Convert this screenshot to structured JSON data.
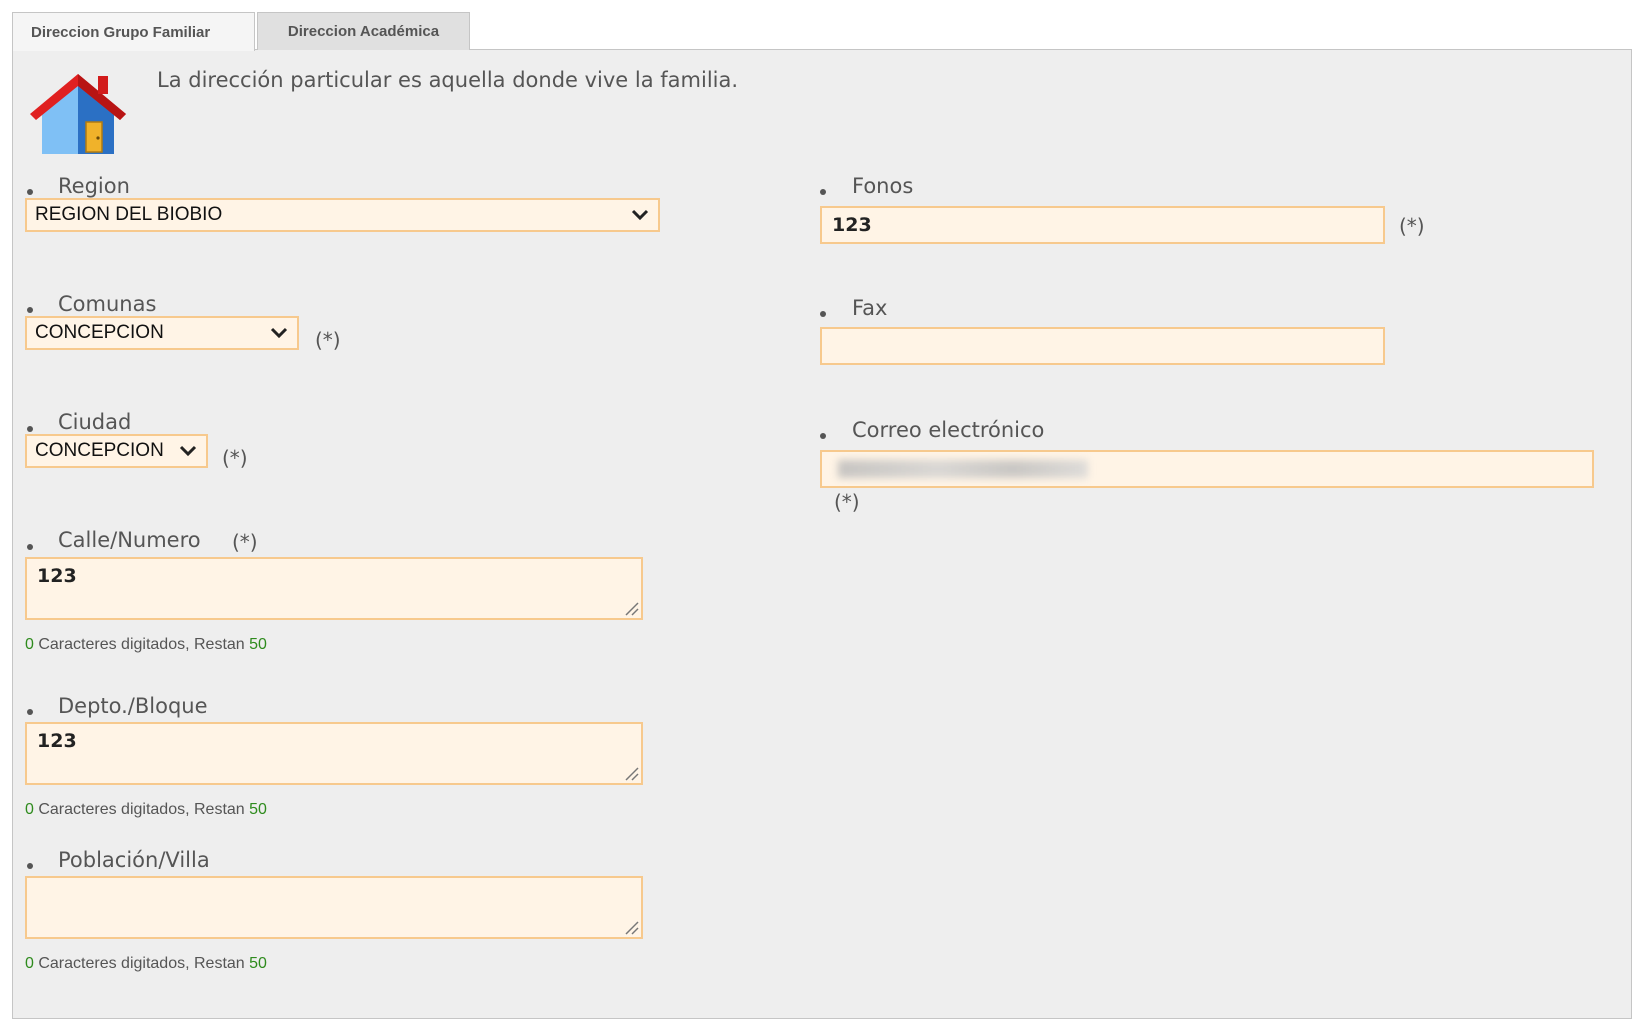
{
  "tabs": [
    {
      "label": "Direccion Grupo Familiar",
      "active": true
    },
    {
      "label": "Direccion Académica",
      "active": false
    }
  ],
  "intro_text": "La dirección particular es aquella donde vive la familia.",
  "required_mark": "(*)",
  "counter": {
    "count": "0",
    "mid_text": " Caracteres digitados, Restan ",
    "remaining": "50"
  },
  "colors": {
    "field_bg": "#fff4e6",
    "field_border": "#f7c98d",
    "counter_green": "#2e8b1d",
    "panel_bg": "#eeeeee"
  },
  "left": {
    "region": {
      "label": "Region",
      "value": "REGION DEL BIOBIO"
    },
    "comunas": {
      "label": "Comunas",
      "value": "CONCEPCION"
    },
    "ciudad": {
      "label": "Ciudad",
      "value": "CONCEPCION"
    },
    "calle": {
      "label": "Calle/Numero",
      "value": "123"
    },
    "depto": {
      "label": "Depto./Bloque",
      "value": "123"
    },
    "poblacion": {
      "label": "Población/Villa",
      "value": ""
    }
  },
  "right": {
    "fonos": {
      "label": "Fonos",
      "value": "123"
    },
    "fax": {
      "label": "Fax",
      "value": ""
    },
    "correo": {
      "label": "Correo electrónico"
    }
  },
  "icons": {
    "house": "house-icon",
    "chevron": "chevron-down-icon",
    "resize": "resize-grip-icon"
  }
}
